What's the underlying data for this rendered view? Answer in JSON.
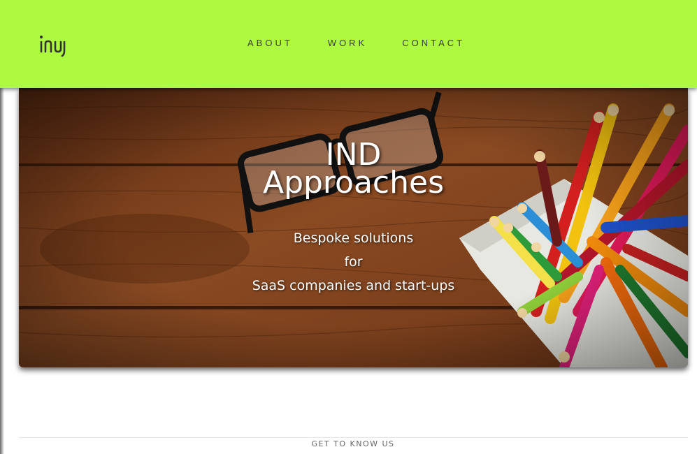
{
  "header": {
    "logo_text": "ind",
    "nav": [
      {
        "label": "ABOUT"
      },
      {
        "label": "WORK"
      },
      {
        "label": "CONTACT"
      }
    ]
  },
  "hero": {
    "title_line1": "IND",
    "title_line2": "Approaches",
    "subtitle_line1": "Bespoke solutions",
    "subtitle_line2": "for",
    "subtitle_line3": "SaaS companies and start-ups"
  },
  "section": {
    "label": "GET TO KNOW US"
  },
  "colors": {
    "nav_background": "#adfa41",
    "wood": "#7a3f1c",
    "text_on_hero": "#ffffff"
  }
}
